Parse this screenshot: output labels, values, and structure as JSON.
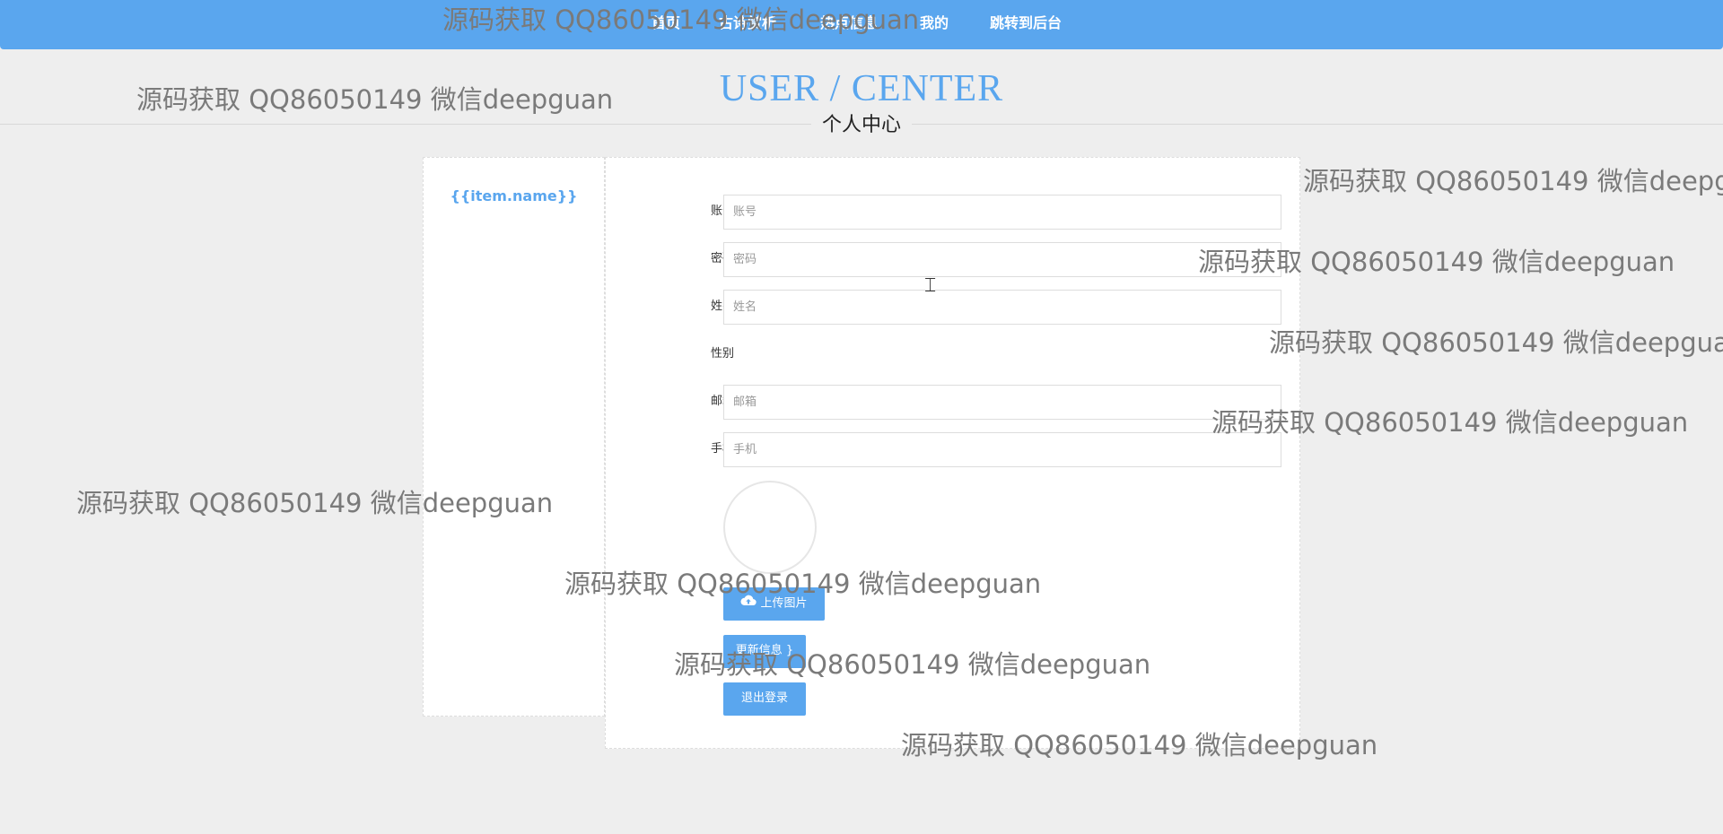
{
  "nav": {
    "items": [
      {
        "label": "首页"
      },
      {
        "label": "古诗赏析"
      },
      {
        "label": "热点信息"
      },
      {
        "label": "我的"
      },
      {
        "label": "跳转到后台"
      }
    ]
  },
  "header": {
    "title_en": "USER / CENTER",
    "title_cn": "个人中心"
  },
  "sidebar": {
    "items": [
      {
        "label": "{{item.name}}"
      }
    ]
  },
  "form": {
    "fields": [
      {
        "label": "账号",
        "placeholder": "账号",
        "value": ""
      },
      {
        "label": "密码",
        "placeholder": "密码",
        "value": ""
      },
      {
        "label": "姓名",
        "placeholder": "姓名",
        "value": ""
      },
      {
        "label": "性别"
      },
      {
        "label": "邮箱",
        "placeholder": "邮箱",
        "value": ""
      },
      {
        "label": "手机",
        "placeholder": "手机",
        "value": ""
      }
    ],
    "upload_label": "上传图片",
    "update_label": "更新信息",
    "logout_label": "退出登录"
  },
  "icons": {
    "upload": "cloud-upload-icon",
    "cursor": "text-cursor-icon"
  },
  "colors": {
    "accent": "#5aa6ee",
    "background": "#eeeeee",
    "card": "#ffffff"
  },
  "watermark": {
    "text": "源码获取 QQ86050149 微信deepguan"
  }
}
